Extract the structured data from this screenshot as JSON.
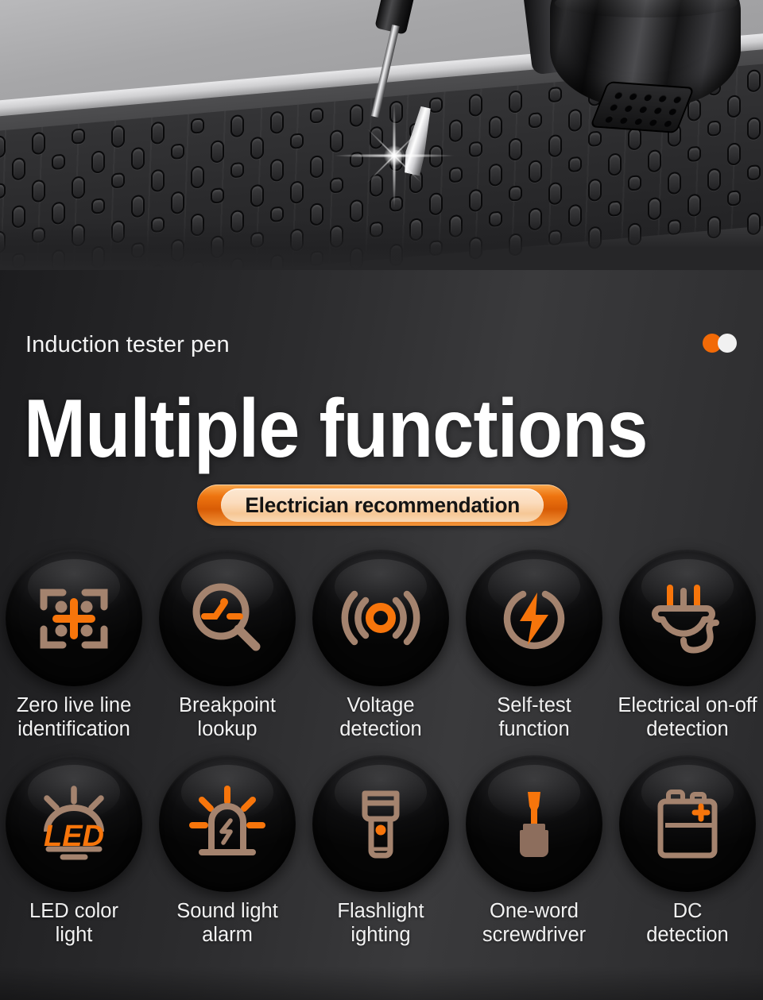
{
  "hero": {
    "alt": "screwdriver-tip-on-perforated-surface-with-spark",
    "device_alt": "black-cylindrical-device-with-speaker-grill"
  },
  "header": {
    "eyebrow": "Induction tester pen",
    "headline": "Multiple functions",
    "badge": "Electrician recommendation"
  },
  "pagination": {
    "dots": [
      {
        "name": "dot-active",
        "color": "#f26a07"
      },
      {
        "name": "dot-inactive",
        "color": "#f1f1f1"
      }
    ]
  },
  "colors": {
    "accent_orange": "#f7750b",
    "icon_tan": "#a47f6c",
    "background_dark": "#2c2c2e",
    "text_white": "#f3f3f3"
  },
  "features": [
    {
      "icon": "zero-live-line-icon",
      "label": "Zero live line\nidentification"
    },
    {
      "icon": "breakpoint-lookup-icon",
      "label": "Breakpoint\nlookup"
    },
    {
      "icon": "voltage-detection-icon",
      "label": "Voltage\ndetection"
    },
    {
      "icon": "self-test-icon",
      "label": "Self-test\nfunction"
    },
    {
      "icon": "power-plug-icon",
      "label": "Electrical on-off\ndetection"
    },
    {
      "icon": "led-light-icon",
      "label": "LED color\nlight"
    },
    {
      "icon": "siren-alarm-icon",
      "label": "Sound light\nalarm"
    },
    {
      "icon": "flashlight-icon",
      "label": "Flashlight\nighting"
    },
    {
      "icon": "screwdriver-icon",
      "label": "One-word\nscrewdriver"
    },
    {
      "icon": "battery-dc-icon",
      "label": "DC\ndetection"
    }
  ],
  "icon_text": {
    "led_label": "LED",
    "battery_plus": "+"
  }
}
